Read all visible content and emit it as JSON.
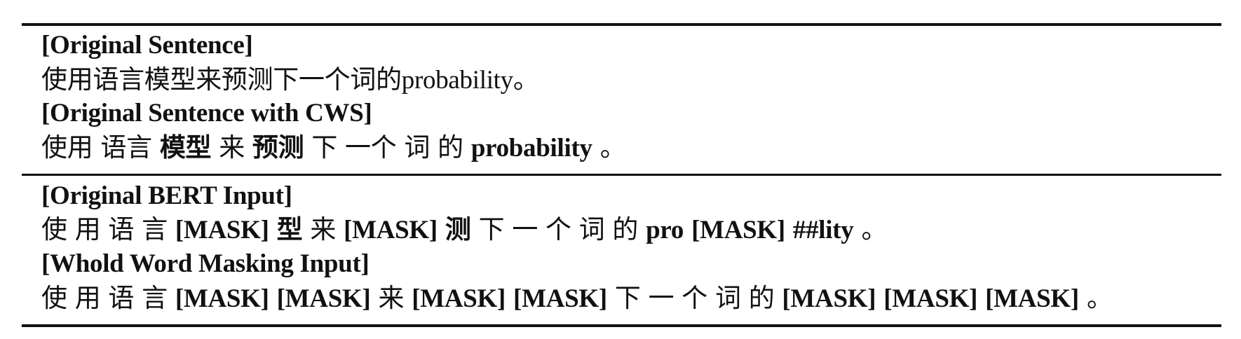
{
  "sections": [
    {
      "rows": [
        {
          "label": "[Original Sentence]",
          "sep": "tight",
          "tokens": [
            {
              "t": "使用语言模型来预测下一个词的probability。",
              "b": false
            }
          ]
        },
        {
          "label": "[Original Sentence with CWS]",
          "sep": "space",
          "tokens": [
            {
              "t": "使用",
              "b": false
            },
            {
              "t": "语言",
              "b": false
            },
            {
              "t": "模型",
              "b": true
            },
            {
              "t": "来",
              "b": false
            },
            {
              "t": "预测",
              "b": true
            },
            {
              "t": "下",
              "b": false
            },
            {
              "t": "一个",
              "b": false
            },
            {
              "t": "词",
              "b": false
            },
            {
              "t": "的",
              "b": false
            },
            {
              "t": "probability",
              "b": true
            },
            {
              "t": "。",
              "b": false
            }
          ]
        }
      ]
    },
    {
      "rows": [
        {
          "label": "[Original BERT Input]",
          "sep": "space",
          "tokens": [
            {
              "t": "使",
              "b": false
            },
            {
              "t": "用",
              "b": false
            },
            {
              "t": "语",
              "b": false
            },
            {
              "t": "言",
              "b": false
            },
            {
              "t": "[MASK]",
              "b": true
            },
            {
              "t": "型",
              "b": true
            },
            {
              "t": "来",
              "b": false
            },
            {
              "t": "[MASK]",
              "b": true
            },
            {
              "t": "测",
              "b": true
            },
            {
              "t": "下",
              "b": false
            },
            {
              "t": "一",
              "b": false
            },
            {
              "t": "个",
              "b": false
            },
            {
              "t": "词",
              "b": false
            },
            {
              "t": "的",
              "b": false
            },
            {
              "t": "pro",
              "b": true
            },
            {
              "t": "[MASK]",
              "b": true
            },
            {
              "t": "##lity",
              "b": true
            },
            {
              "t": "。",
              "b": false
            }
          ]
        },
        {
          "label": "[Whold Word Masking Input]",
          "sep": "space",
          "tokens": [
            {
              "t": "使",
              "b": false
            },
            {
              "t": "用",
              "b": false
            },
            {
              "t": "语",
              "b": false
            },
            {
              "t": "言",
              "b": false
            },
            {
              "t": "[MASK]",
              "b": true
            },
            {
              "t": "[MASK]",
              "b": true
            },
            {
              "t": "来",
              "b": false
            },
            {
              "t": "[MASK]",
              "b": true
            },
            {
              "t": "[MASK]",
              "b": true
            },
            {
              "t": "下",
              "b": false
            },
            {
              "t": "一",
              "b": false
            },
            {
              "t": "个",
              "b": false
            },
            {
              "t": "词",
              "b": false
            },
            {
              "t": "的",
              "b": false
            },
            {
              "t": "[MASK]",
              "b": true
            },
            {
              "t": "[MASK]",
              "b": true
            },
            {
              "t": "[MASK]",
              "b": true
            },
            {
              "t": "。",
              "b": false
            }
          ]
        }
      ]
    }
  ]
}
